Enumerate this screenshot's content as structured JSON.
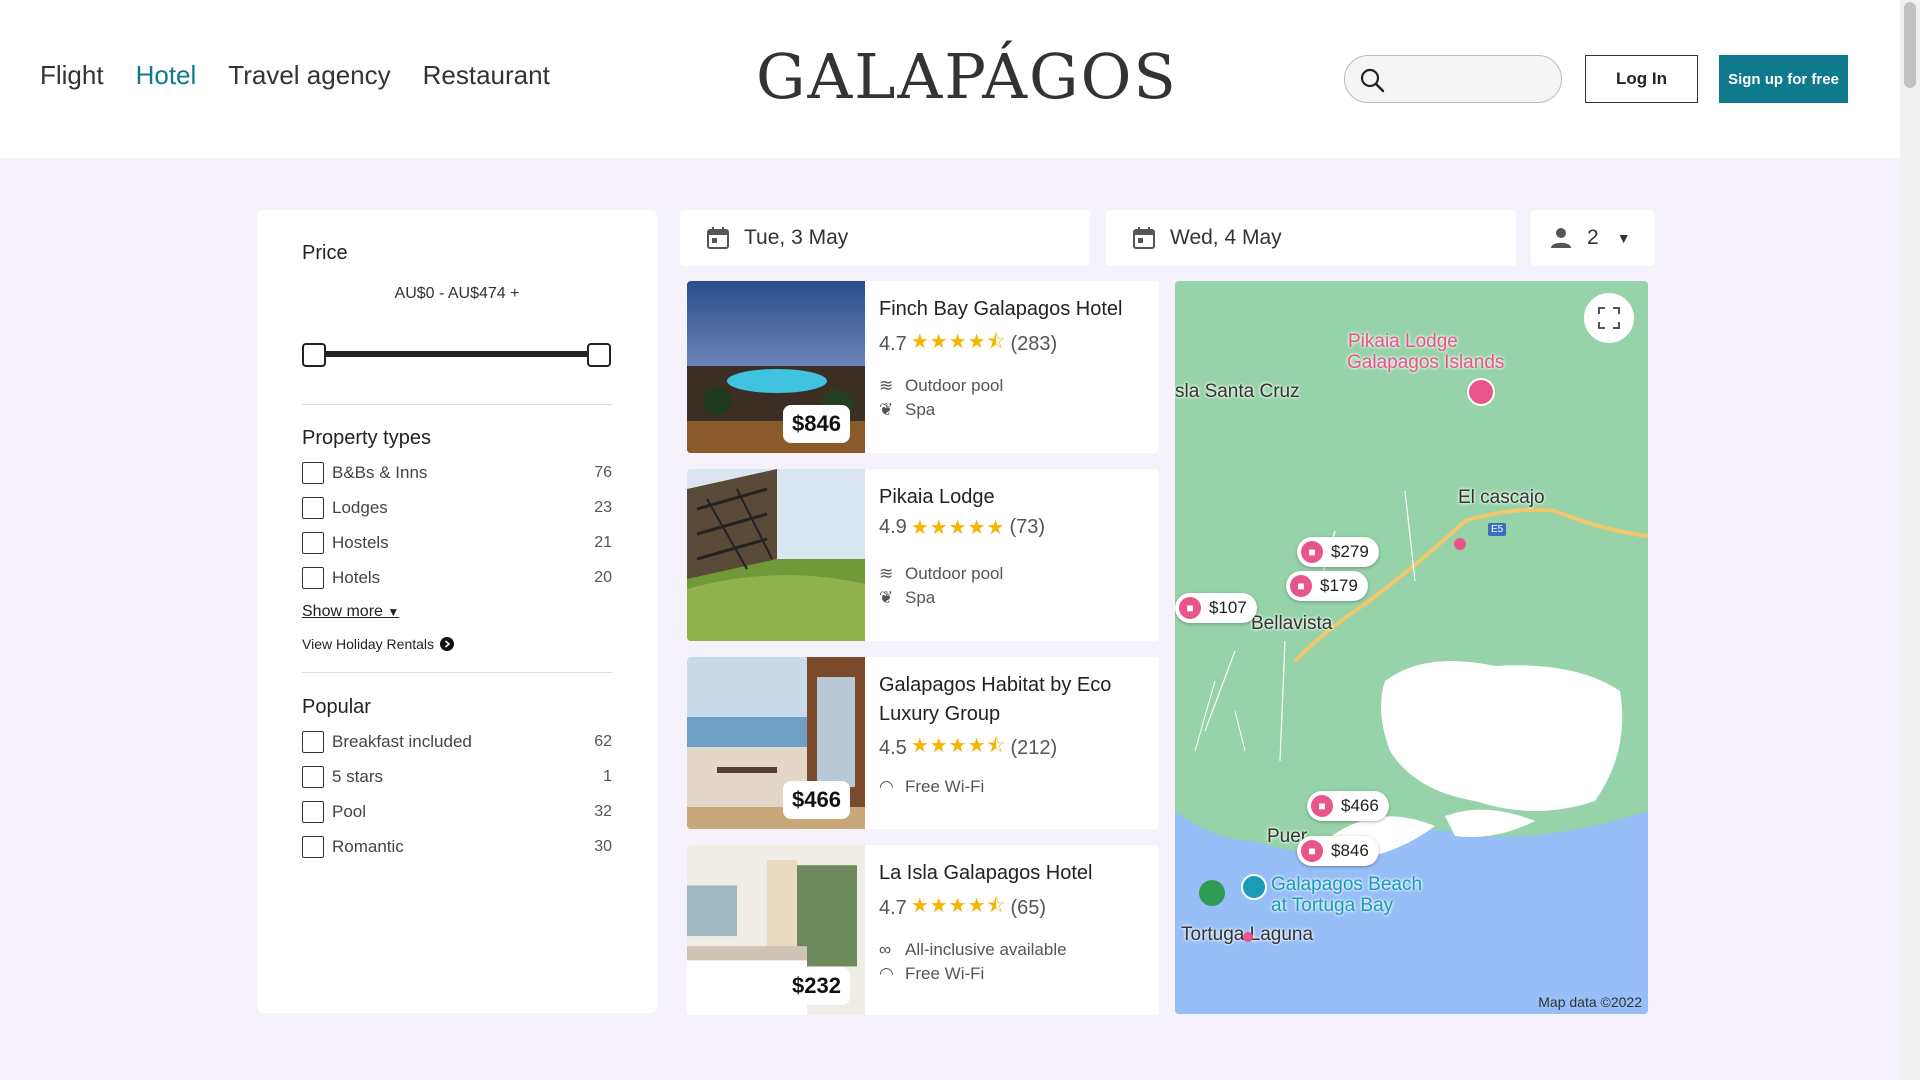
{
  "header": {
    "nav": [
      "Flight",
      "Hotel",
      "Travel agency",
      "Restaurant"
    ],
    "active_nav": "Hotel",
    "logo": "GALAPÁGOS",
    "search": {
      "value": "",
      "placeholder": ""
    },
    "login_label": "Log In",
    "signup_label": "Sign up for free"
  },
  "colors": {
    "accent": "#0f7a8c",
    "star": "#f4b400",
    "pin": "#e8558b",
    "map_land": "#96d3a8",
    "map_water": "#97bef7"
  },
  "filters": {
    "price": {
      "title": "Price",
      "range": "AU$0 - AU$474 +",
      "min_fraction": 0.0,
      "max_fraction": 1.0
    },
    "property_types": {
      "title": "Property types",
      "items": [
        {
          "label": "B&Bs & Inns",
          "count": "76"
        },
        {
          "label": "Lodges",
          "count": "23"
        },
        {
          "label": "Hostels",
          "count": "21"
        },
        {
          "label": "Hotels",
          "count": "20"
        }
      ],
      "show_more": "Show more",
      "view_rentals": "View Holiday Rentals"
    },
    "popular": {
      "title": "Popular",
      "items": [
        {
          "label": "Breakfast included",
          "count": "62"
        },
        {
          "label": "5 stars",
          "count": "1"
        },
        {
          "label": "Pool",
          "count": "32"
        },
        {
          "label": "Romantic",
          "count": "30"
        }
      ]
    }
  },
  "search_bar": {
    "checkin": "Tue, 3 May",
    "checkout": "Wed, 4 May",
    "guests": "2"
  },
  "hotels": [
    {
      "name": "Finch Bay Galapagos Hotel",
      "rating": "4.7",
      "stars": "★★★★⯪",
      "reviews": "(283)",
      "price": "$846",
      "amenities": [
        "Outdoor pool",
        "Spa"
      ]
    },
    {
      "name": "Pikaia Lodge",
      "rating": "4.9",
      "stars": "★★★★★",
      "reviews": "(73)",
      "price": "",
      "amenities": [
        "Outdoor pool",
        "Spa"
      ]
    },
    {
      "name": "Galapagos Habitat by Eco Luxury Group",
      "rating": "4.5",
      "stars": "★★★★⯪",
      "reviews": "(212)",
      "price": "$466",
      "amenities": [
        "Free Wi-Fi"
      ]
    },
    {
      "name": "La Isla Galapagos Hotel",
      "rating": "4.7",
      "stars": "★★★★⯪",
      "reviews": "(65)",
      "price": "$232",
      "amenities": [
        "All-inclusive available",
        "Free Wi-Fi"
      ]
    }
  ],
  "map": {
    "labels": {
      "pikaia_1": "Pikaia Lodge",
      "pikaia_2": "Galapagos Islands",
      "santa_cruz": "sla Santa Cruz",
      "cascajo": "El cascajo",
      "bellavista": "Bellavista",
      "puerto": "Puer",
      "beach_1": "Galapagos Beach",
      "beach_2": "at Tortuga Bay",
      "laguna": "Tortuga Laguna",
      "road": "E5"
    },
    "pins": [
      "$279",
      "$179",
      "$107",
      "$466",
      "$846"
    ],
    "attribution": "Map data ©2022"
  }
}
